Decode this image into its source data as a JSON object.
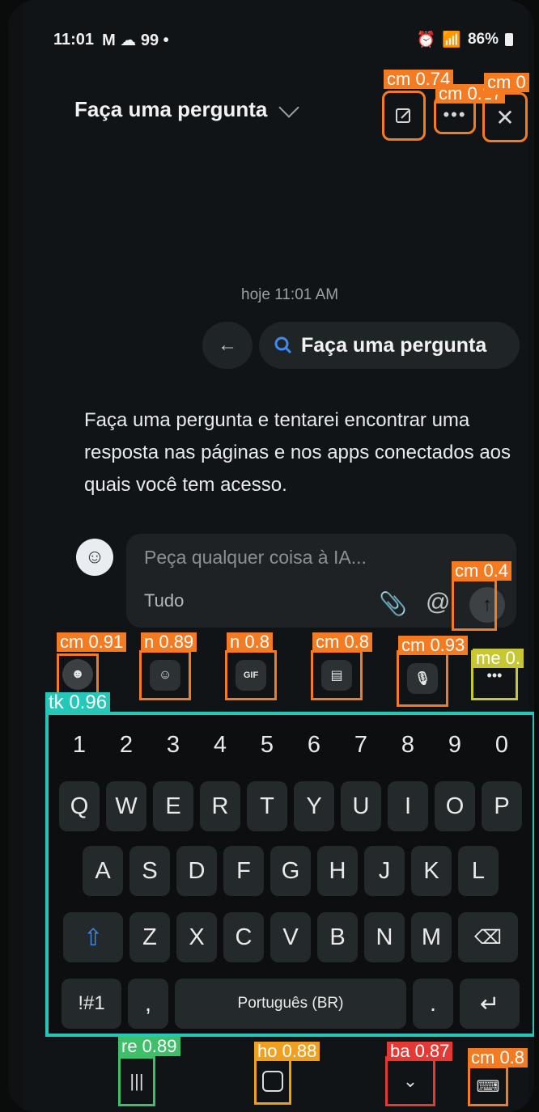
{
  "status_bar": {
    "time": "11:01",
    "left_icons": "M ☁ 99 •",
    "battery": "86%"
  },
  "header": {
    "title": "Faça uma pergunta",
    "annotations": {
      "edit": "cm 0.74",
      "more": "cm 0.27",
      "close": "cm 0"
    }
  },
  "chat": {
    "timestamp": "hoje 11:01 AM",
    "back_arrow": "←",
    "query_chip": "Faça uma pergunta",
    "message": "Faça uma pergunta e tentarei encontrar uma resposta nas páginas e nos apps conectados aos quais você tem acesso."
  },
  "composer": {
    "placeholder": "Peça qualquer coisa à IA...",
    "scope": "Tudo",
    "send_annotation": "cm 0.4"
  },
  "keyboard_toolbar": {
    "annotations": [
      "cm 0.91",
      "n 0.89",
      "n 0.8",
      "cm 0.8",
      "cm 0.93",
      "me 0."
    ],
    "gif_label": "GIF"
  },
  "keyboard": {
    "annotation": "tk 0.96",
    "numbers": [
      "1",
      "2",
      "3",
      "4",
      "5",
      "6",
      "7",
      "8",
      "9",
      "0"
    ],
    "row1": [
      "Q",
      "W",
      "E",
      "R",
      "T",
      "Y",
      "U",
      "I",
      "O",
      "P"
    ],
    "row2": [
      "A",
      "S",
      "D",
      "F",
      "G",
      "H",
      "J",
      "K",
      "L"
    ],
    "row3": [
      "Z",
      "X",
      "C",
      "V",
      "B",
      "N",
      "M"
    ],
    "symbols": "!#1",
    "comma": ",",
    "space": "Português (BR)",
    "period": "."
  },
  "navbar": {
    "annotations": [
      "re 0.89",
      "ho 0.88",
      "ba 0.87",
      "cm 0.8"
    ]
  },
  "colors": {
    "annotation_orange": "#f47b22",
    "annotation_teal": "#24c7b8",
    "annotation_green": "#3fbf6a",
    "annotation_olive": "#c7c733",
    "annotation_red": "#e53935",
    "annotation_amber": "#f0a020"
  }
}
